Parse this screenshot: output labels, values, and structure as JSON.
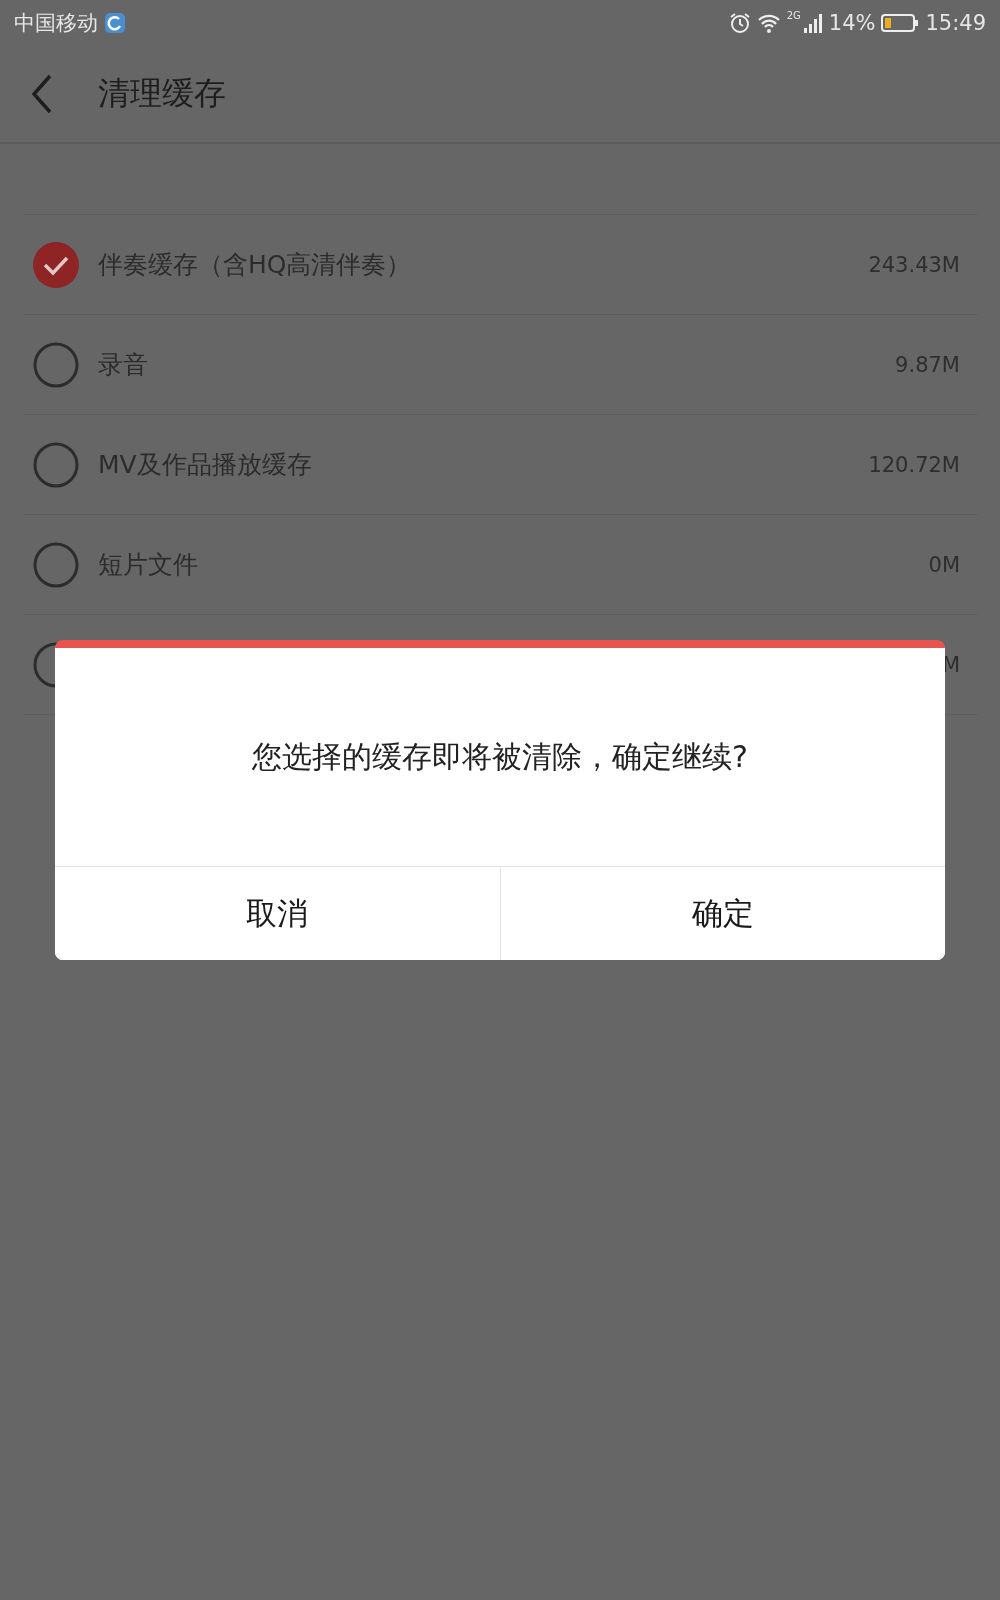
{
  "status_bar": {
    "carrier": "中国移动",
    "network": "2G",
    "battery": "14%",
    "time": "15:49"
  },
  "header": {
    "title": "清理缓存"
  },
  "items": [
    {
      "label": "伴奏缓存（含HQ高清伴奏）",
      "size": "243.43M",
      "checked": true
    },
    {
      "label": "录音",
      "size": "9.87M",
      "checked": false
    },
    {
      "label": "MV及作品播放缓存",
      "size": "120.72M",
      "checked": false
    },
    {
      "label": "短片文件",
      "size": "0M",
      "checked": false
    },
    {
      "size": "M",
      "checked": false
    }
  ],
  "dialog": {
    "message": "您选择的缓存即将被清除，确定继续?",
    "buttons": [
      "取消",
      "确定"
    ]
  }
}
